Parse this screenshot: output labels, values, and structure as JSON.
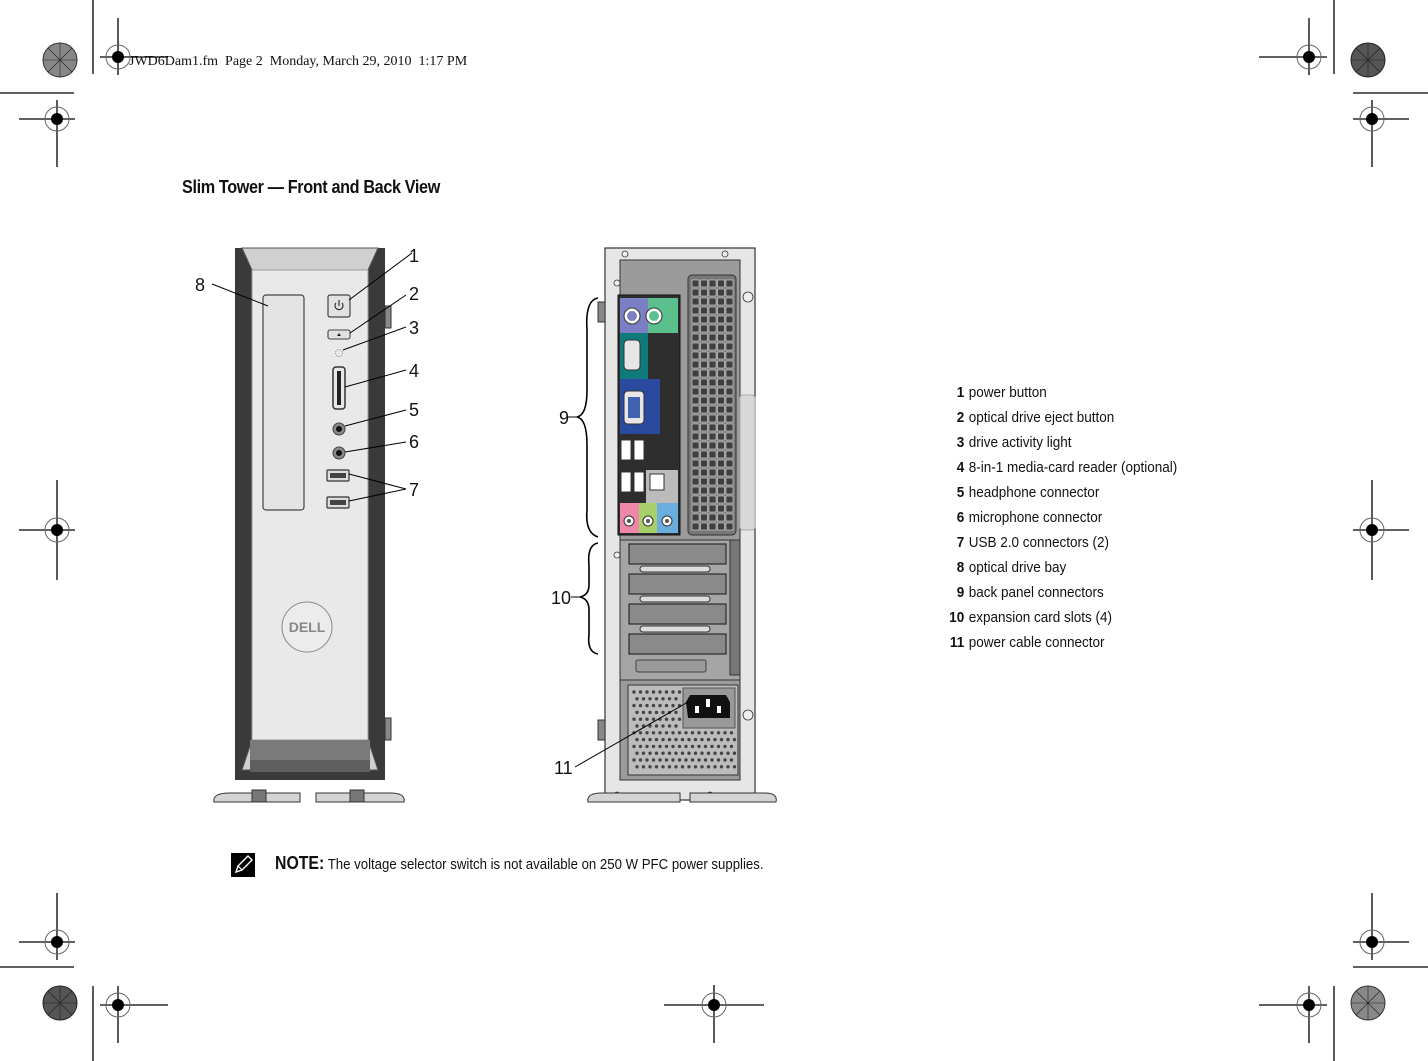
{
  "print_header": "JWD6Dam1.fm  Page 2  Monday, March 29, 2010  1:17 PM",
  "section_title": "Slim Tower — Front and Back View",
  "callouts": {
    "front": [
      "1",
      "2",
      "3",
      "4",
      "5",
      "6",
      "7",
      "8"
    ],
    "back": [
      "9",
      "10",
      "11"
    ]
  },
  "logo_text": "DELL",
  "legend": [
    {
      "num": "1",
      "label": "power button"
    },
    {
      "num": "2",
      "label": "optical drive eject button"
    },
    {
      "num": "3",
      "label": "drive activity light"
    },
    {
      "num": "4",
      "label": "8-in-1 media-card reader (optional)"
    },
    {
      "num": "5",
      "label": "headphone connector"
    },
    {
      "num": "6",
      "label": "microphone connector"
    },
    {
      "num": "7",
      "label": "USB 2.0 connectors (2)"
    },
    {
      "num": "8",
      "label": "optical drive bay"
    },
    {
      "num": "9",
      "label": "back panel connectors"
    },
    {
      "num": "10",
      "label": "expansion card slots (4)"
    },
    {
      "num": "11",
      "label": "power cable connector"
    }
  ],
  "note": {
    "label": "NOTE:",
    "text": "The voltage selector switch is not available on 250 W PFC power supplies."
  },
  "colors": {
    "ps2_keyboard": "#7b7fc4",
    "ps2_mouse": "#5cc08e",
    "serial": "#0f7a7a",
    "vga": "#2a4aa0",
    "audio_line_in": "#ef87a8",
    "audio_line_out": "#a7cf6a",
    "audio_mic": "#6aaee0",
    "chassis_light": "#e8e8e8",
    "chassis_dark": "#4a4a4a"
  }
}
